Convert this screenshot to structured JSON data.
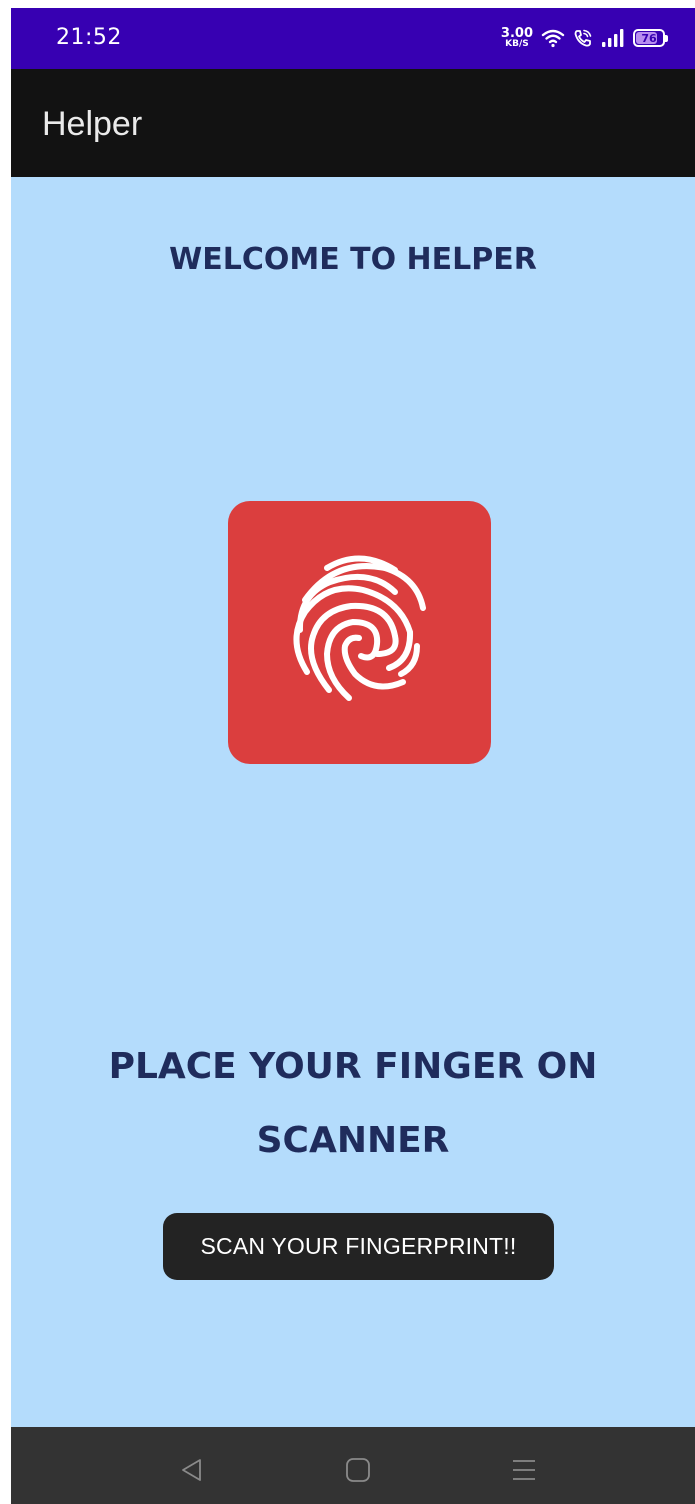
{
  "status_bar": {
    "time": "21:52",
    "net_speed_value": "3.00",
    "net_speed_unit": "KB/S",
    "battery_level": "76",
    "icons": [
      "wifi-icon",
      "wifi-calling-icon",
      "signal-icon",
      "battery-icon"
    ]
  },
  "app_bar": {
    "title": "Helper"
  },
  "main": {
    "welcome_text": "WELCOME TO HELPER",
    "fingerprint_icon": "fingerprint-icon",
    "instruction_line1": "PLACE YOUR FINGER ON",
    "instruction_line2": "SCANNER",
    "toast_text": "SCAN YOUR FINGERPRINT!!"
  },
  "nav_bar": {
    "buttons": [
      "back-icon",
      "home-icon",
      "recents-icon"
    ]
  },
  "colors": {
    "status_bar": "#3700b2",
    "app_bar": "#121212",
    "background": "#b4dcfc",
    "heading_text": "#1f2c5c",
    "fingerprint_tile": "#db3e3e",
    "toast": "#232323",
    "nav_bar": "#333333"
  }
}
